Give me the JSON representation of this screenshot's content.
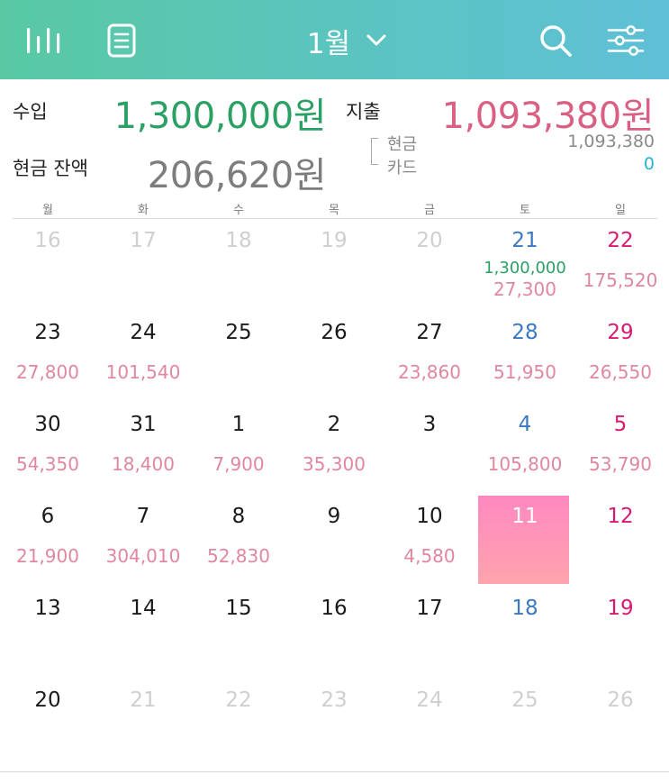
{
  "header": {
    "month": "1월",
    "icons": {
      "stats": "bar-chart-icon",
      "list": "document-icon",
      "dropdown": "chevron-down-icon",
      "search": "search-icon",
      "filter": "sliders-icon"
    }
  },
  "summary": {
    "income_label": "수입",
    "income_amount": "1,300,000원",
    "expense_label": "지출",
    "expense_amount": "1,093,380원",
    "balance_label": "현금 잔액",
    "balance_amount": "206,620원",
    "cash_label": "현금",
    "cash_amount": "1,093,380",
    "card_label": "카드",
    "card_amount": "0"
  },
  "weekdays": [
    "월",
    "화",
    "수",
    "목",
    "금",
    "토",
    "일"
  ],
  "weeks": [
    [
      {
        "day": "16",
        "muted": true
      },
      {
        "day": "17",
        "muted": true
      },
      {
        "day": "18",
        "muted": true
      },
      {
        "day": "19",
        "muted": true
      },
      {
        "day": "20",
        "muted": true
      },
      {
        "day": "21",
        "income": "1,300,000",
        "expense": "27,300"
      },
      {
        "day": "22",
        "expense": "175,520"
      }
    ],
    [
      {
        "day": "23",
        "expense": "27,800"
      },
      {
        "day": "24",
        "expense": "101,540"
      },
      {
        "day": "25"
      },
      {
        "day": "26"
      },
      {
        "day": "27",
        "expense": "23,860"
      },
      {
        "day": "28",
        "expense": "51,950"
      },
      {
        "day": "29",
        "expense": "26,550"
      }
    ],
    [
      {
        "day": "30",
        "expense": "54,350"
      },
      {
        "day": "31",
        "expense": "18,400"
      },
      {
        "day": "1",
        "expense": "7,900"
      },
      {
        "day": "2",
        "expense": "35,300"
      },
      {
        "day": "3"
      },
      {
        "day": "4",
        "expense": "105,800"
      },
      {
        "day": "5",
        "expense": "53,790"
      }
    ],
    [
      {
        "day": "6",
        "expense": "21,900"
      },
      {
        "day": "7",
        "expense": "304,010"
      },
      {
        "day": "8",
        "expense": "52,830"
      },
      {
        "day": "9"
      },
      {
        "day": "10",
        "expense": "4,580"
      },
      {
        "day": "11",
        "today": true
      },
      {
        "day": "12"
      }
    ],
    [
      {
        "day": "13"
      },
      {
        "day": "14"
      },
      {
        "day": "15"
      },
      {
        "day": "16"
      },
      {
        "day": "17"
      },
      {
        "day": "18"
      },
      {
        "day": "19"
      }
    ],
    [
      {
        "day": "20"
      },
      {
        "day": "21",
        "muted": true
      },
      {
        "day": "22",
        "muted": true
      },
      {
        "day": "23",
        "muted": true
      },
      {
        "day": "24",
        "muted": true
      },
      {
        "day": "25",
        "muted": true
      },
      {
        "day": "26",
        "muted": true
      }
    ]
  ],
  "colors": {
    "header_start": "#58c9a3",
    "header_end": "#5fbfd6",
    "income": "#2aa065",
    "expense": "#d95f83",
    "saturday": "#3a78c2",
    "sunday": "#d81b72",
    "today_start": "#ff88c0",
    "today_end": "#ffa4ae",
    "card_amount": "#2ab0d0"
  }
}
